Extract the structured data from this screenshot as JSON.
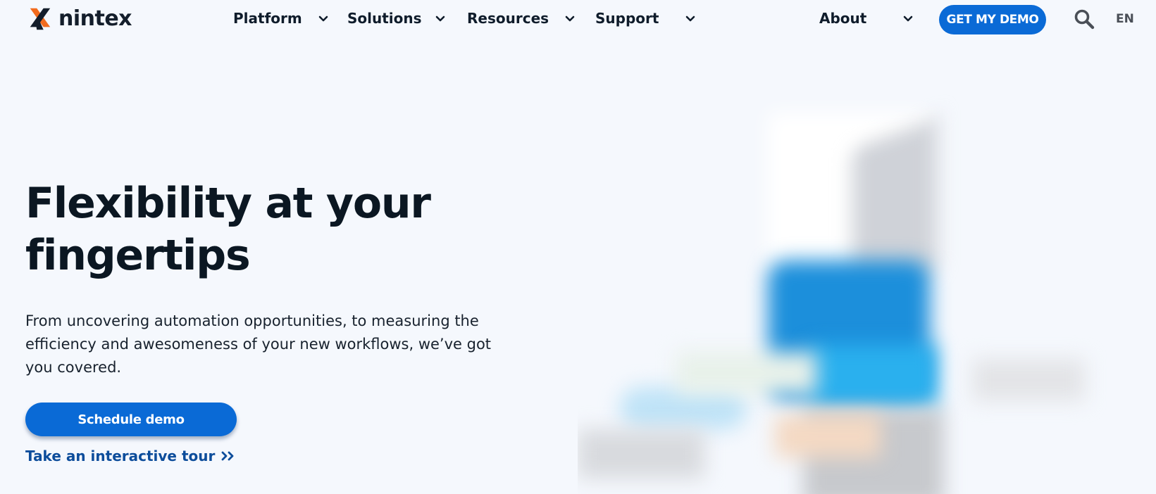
{
  "header": {
    "brand": "nintex",
    "nav": [
      {
        "label": "Platform"
      },
      {
        "label": "Solutions"
      },
      {
        "label": "Resources"
      },
      {
        "label": "Support"
      },
      {
        "label": "About"
      }
    ],
    "cta_label": "GET MY DEMO",
    "lang": "EN"
  },
  "hero": {
    "title": "Flexibility at your fingertips",
    "description": "From uncovering automation opportunities, to measuring the efficiency and awesomeness of your new workflows, we’ve got you covered.",
    "primary_cta": "Schedule demo",
    "secondary_link": "Take an interactive tour"
  },
  "icons": {
    "logo": "nintex-x-logo-icon",
    "chevron": "chevron-down-icon",
    "search": "search-icon",
    "tour": "double-chevron-right-icon"
  },
  "colors": {
    "background": "#f5f8fd",
    "accent": "#0a6ad6",
    "logo_orange": "#f26b1d",
    "text_dark": "#0b1722",
    "link": "#0d4d9b"
  }
}
